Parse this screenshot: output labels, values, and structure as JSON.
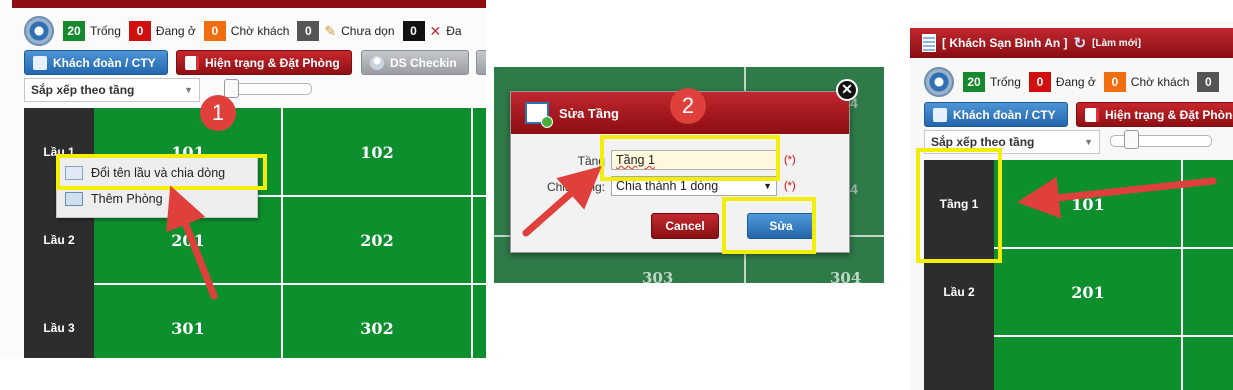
{
  "stats": [
    {
      "count": "20",
      "label": "Trống",
      "color": "#148a2c",
      "kind": "green"
    },
    {
      "count": "0",
      "label": "Đang ở",
      "color": "#d10f0f",
      "kind": "red"
    },
    {
      "count": "0",
      "label": "Chờ khách",
      "color": "#f06d10",
      "kind": "orange"
    },
    {
      "count": "0",
      "label": "Chưa dọn",
      "color": "#555555",
      "kind": "gray"
    },
    {
      "count": "0",
      "label": "Đa",
      "color": "#111111",
      "kind": "black"
    }
  ],
  "toolbar": {
    "group_btn": "Khách đoàn / CTY",
    "status_btn": "Hiện trạng & Đặt Phòng",
    "checkin_btn": "DS Checkin",
    "sort_select": "Sắp xếp theo tầng",
    "status_btn_cut": "Hiện trạng & Đặt Phòng"
  },
  "panel1": {
    "floors": [
      "Lầu 1",
      "Lầu 2",
      "Lầu 3"
    ],
    "rooms": [
      [
        "101",
        "102"
      ],
      [
        "201",
        "202"
      ],
      [
        "301",
        "302"
      ]
    ],
    "context_menu": {
      "rename": "Đổi tên lầu và chia dòng",
      "add_room": "Thêm Phòng"
    },
    "step": "1"
  },
  "panel2": {
    "bg_rooms": [
      "303",
      "304",
      "4",
      "4"
    ],
    "dialog": {
      "title": "Sửa Tầng",
      "floor_label": "Tầng",
      "floor_value": "Tầng 1",
      "split_label": "Chia dòng:",
      "split_value": "Chia thành 1 dòng",
      "required": "(*)",
      "cancel": "Cancel",
      "submit": "Sửa"
    },
    "close_glyph": "✕",
    "step": "2"
  },
  "panel3": {
    "hotel_name": "[ Khách Sạn Bình An ]",
    "reload": "[Làm mới]",
    "stats_visible": [
      {
        "count": "20",
        "label": "Trống"
      },
      {
        "count": "0",
        "label": "Đang ở"
      },
      {
        "count": "0",
        "label": "Chờ khách"
      },
      {
        "count": "0",
        "label": ""
      }
    ],
    "floors": [
      "Tầng 1",
      "Lầu 2"
    ],
    "rooms": [
      "101",
      "201"
    ]
  },
  "colors": {
    "room_green": "#0e8f2d",
    "floor_dark": "#2d2d2d",
    "header_red": "#a8161c",
    "highlight": "#f2ee0a",
    "arrow": "#e0403c"
  }
}
